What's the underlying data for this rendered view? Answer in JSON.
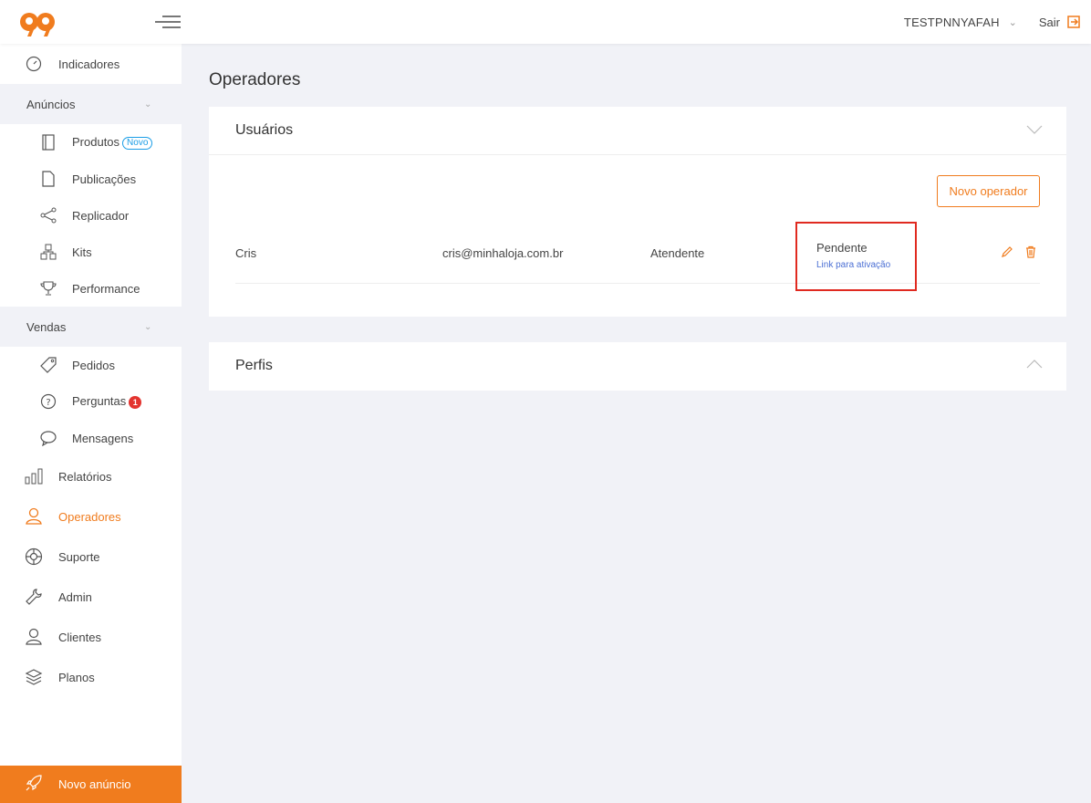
{
  "header": {
    "username": "TESTPNNYAFAH",
    "logout_label": "Sair",
    "accent_color": "#f07c1e"
  },
  "sidebar": {
    "indicadores": "Indicadores",
    "anuncios": {
      "label": "Anúncios",
      "items": [
        {
          "label": "Produtos",
          "badge": "Novo",
          "icon": "notebook-icon"
        },
        {
          "label": "Publicações",
          "icon": "file-icon"
        },
        {
          "label": "Replicador",
          "icon": "share-icon"
        },
        {
          "label": "Kits",
          "icon": "kits-icon"
        },
        {
          "label": "Performance",
          "icon": "trophy-icon"
        }
      ]
    },
    "vendas": {
      "label": "Vendas",
      "items": [
        {
          "label": "Pedidos",
          "icon": "tag-icon"
        },
        {
          "label": "Perguntas",
          "badge": "1",
          "icon": "question-icon"
        },
        {
          "label": "Mensagens",
          "icon": "chat-icon"
        }
      ]
    },
    "relatorios": "Relatórios",
    "operadores": "Operadores",
    "suporte": "Suporte",
    "admin": "Admin",
    "clientes": "Clientes",
    "planos": "Planos",
    "novo_anuncio": "Novo anúncio"
  },
  "main": {
    "title": "Operadores",
    "usuarios": {
      "title": "Usuários",
      "new_button": "Novo operador",
      "rows": [
        {
          "name": "Cris",
          "email": "cris@minhaloja.com.br",
          "role": "Atendente",
          "status": "Pendente",
          "activation_link": "Link para ativação"
        }
      ]
    },
    "perfis": {
      "title": "Perfis"
    }
  }
}
